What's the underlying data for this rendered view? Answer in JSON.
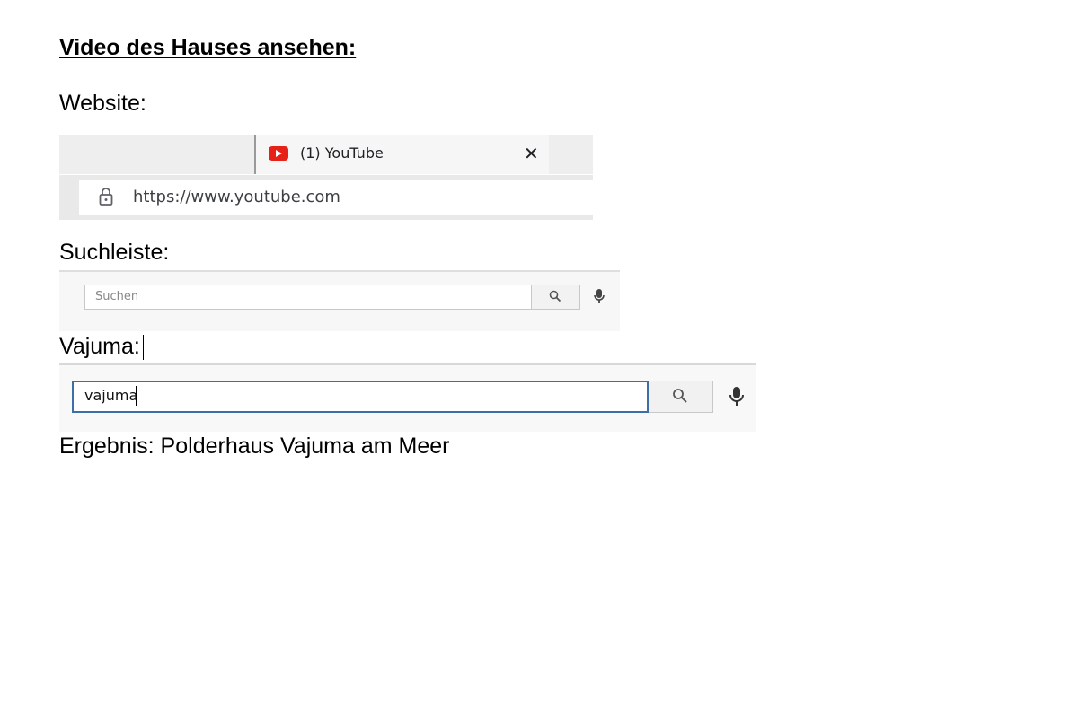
{
  "document": {
    "heading": "Video des Hauses ansehen:",
    "website_label": "Website:",
    "searchbar_label": "Suchleiste:",
    "vajuma_label": "Vajuma:",
    "result_text": "Ergebnis: Polderhaus Vajuma am Meer"
  },
  "browser_screenshot": {
    "tab": {
      "icon": "youtube-logo-icon",
      "title": "(1) YouTube",
      "close_glyph": "✕"
    },
    "address_bar": {
      "icon": "lock-icon",
      "url": "https://www.youtube.com"
    }
  },
  "search_screenshot": {
    "placeholder": "Suchen",
    "search_icon": "search-icon",
    "mic_icon": "mic-icon"
  },
  "vajuma_screenshot": {
    "query": "vajuma",
    "search_icon": "search-icon",
    "mic_icon": "mic-icon"
  },
  "colors": {
    "youtube_red": "#e62117",
    "focus_border": "#3d6ea8"
  }
}
